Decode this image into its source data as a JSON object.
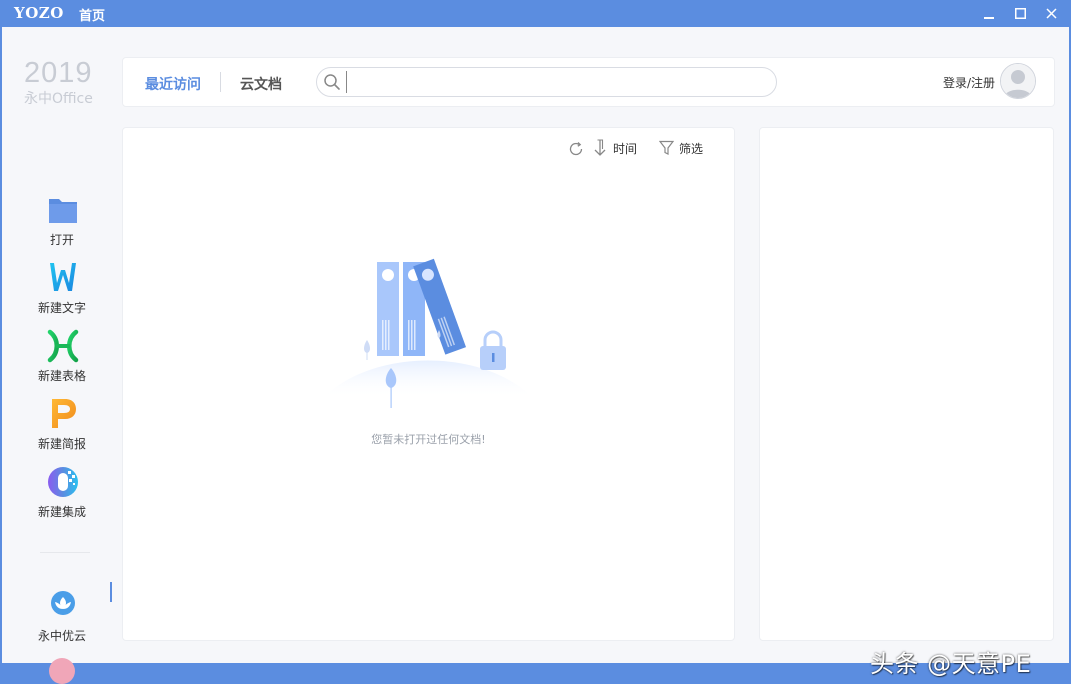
{
  "window": {
    "brand": "YOZO",
    "title": "首页",
    "controls": {
      "minimize": "minimize-icon",
      "maximize": "maximize-icon",
      "close": "close-icon"
    }
  },
  "logo": {
    "year": "2019",
    "product": "永中Office"
  },
  "tabs": [
    {
      "label": "最近访问",
      "active": true
    },
    {
      "label": "云文档",
      "active": false
    }
  ],
  "search": {
    "placeholder": "",
    "value": "",
    "icon": "search-icon"
  },
  "account": {
    "login_label": "登录/注册",
    "avatar_icon": "user-avatar-icon"
  },
  "sidebar": {
    "items": [
      {
        "label": "打开",
        "icon": "folder-icon"
      },
      {
        "label": "新建文字",
        "icon": "writer-w-icon"
      },
      {
        "label": "新建表格",
        "icon": "sheet-x-icon"
      },
      {
        "label": "新建简报",
        "icon": "presentation-p-icon"
      },
      {
        "label": "新建集成",
        "icon": "integrated-o-icon"
      },
      {
        "label": "永中优云",
        "icon": "cloud-flower-icon"
      }
    ]
  },
  "list_toolbar": {
    "refresh_icon": "refresh-icon",
    "sort_icon": "sort-down-arrow-icon",
    "sort_label": "时间",
    "filter_icon": "filter-funnel-icon",
    "filter_label": "筛选"
  },
  "empty_state": {
    "message": "您暂未打开过任何文档!"
  },
  "watermark": "头条 @天意PE",
  "colors": {
    "accent": "#5b8de0",
    "writer": "#1fb3e8",
    "sheet": "#22c25a",
    "presentation": "#f5a62b",
    "folder": "#5b8de0"
  }
}
